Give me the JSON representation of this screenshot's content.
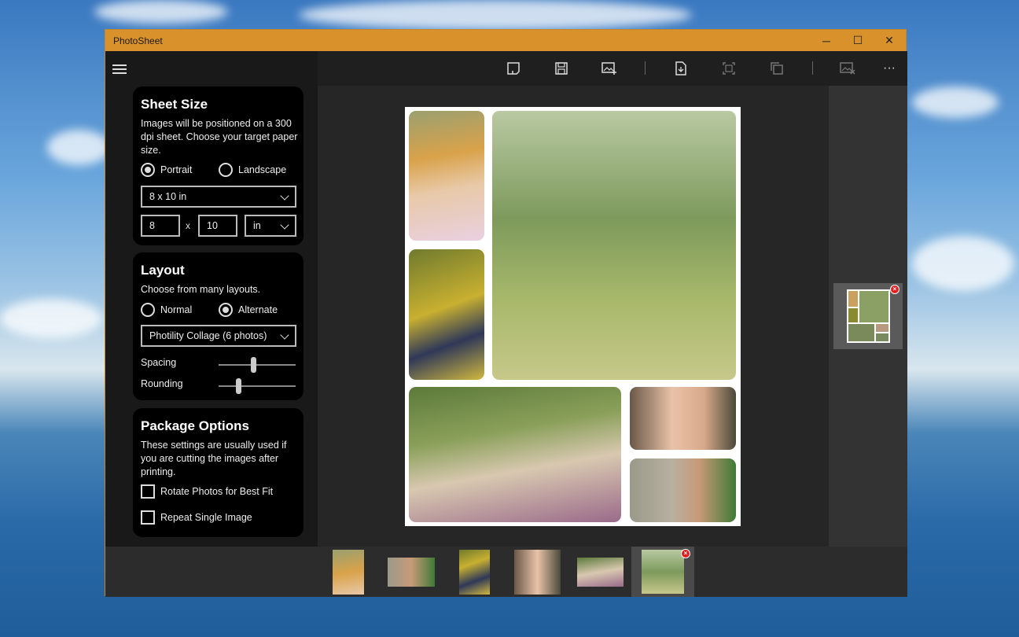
{
  "window": {
    "title": "PhotoSheet",
    "minimize": "─",
    "maximize": "☐",
    "close": "✕"
  },
  "sheet_size": {
    "heading": "Sheet Size",
    "description": "Images will be positioned on a 300 dpi sheet. Choose your target paper size.",
    "orientation": {
      "portrait": "Portrait",
      "landscape": "Landscape",
      "selected": "Portrait"
    },
    "preset": "8 x 10 in",
    "width": "8",
    "times": "x",
    "height": "10",
    "unit": "in"
  },
  "layout": {
    "heading": "Layout",
    "description": "Choose from many layouts.",
    "modes": {
      "normal": "Normal",
      "alternate": "Alternate",
      "selected": "Alternate"
    },
    "preset": "Photility Collage (6 photos)",
    "spacing_label": "Spacing",
    "spacing_value": 0.45,
    "rounding_label": "Rounding",
    "rounding_value": 0.24
  },
  "package": {
    "heading": "Package Options",
    "description": "These settings are usually used if you are cutting the images after printing.",
    "rotate_label": "Rotate Photos for Best Fit",
    "rotate_checked": false,
    "repeat_label": "Repeat Single Image",
    "repeat_checked": false
  },
  "toolbar": {
    "icons": [
      "new-sheet-icon",
      "save-icon",
      "add-image-icon",
      "export-page-icon",
      "crop-icon",
      "copy-icon",
      "remove-image-icon",
      "more-icon"
    ],
    "more_label": "···"
  },
  "badges": {
    "remove": "×"
  },
  "colors": {
    "title_bar": "#d8912b",
    "panel_bg": "#191919",
    "card_bg": "#000000",
    "sheet_bg": "#ffffff",
    "badge": "#e02020"
  }
}
